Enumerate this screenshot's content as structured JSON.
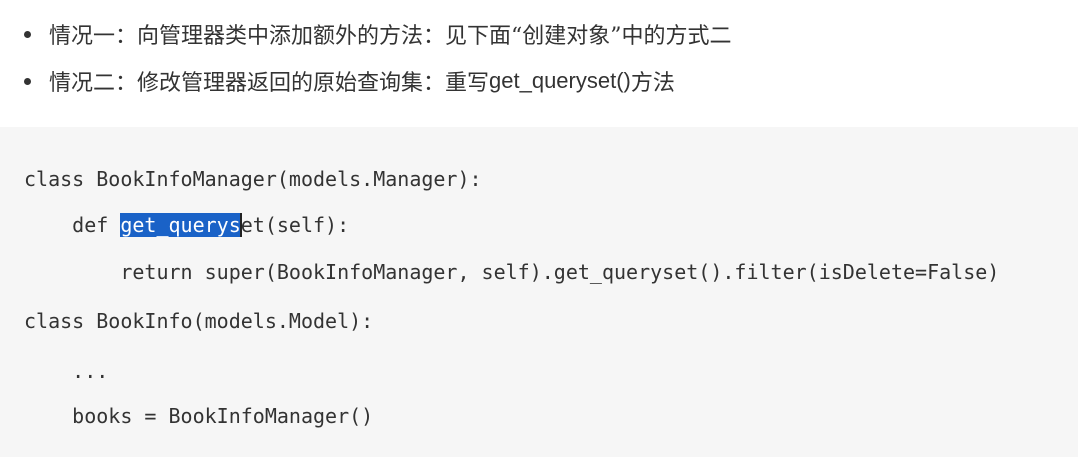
{
  "bullets": [
    {
      "text": "情况一：向管理器类中添加额外的方法：见下面“创建对象”中的方式二"
    },
    {
      "text_before": "情况二：修改管理器返回的原始查询集：重写",
      "text_code": "get_queryset()",
      "text_after": "方法"
    }
  ],
  "code": {
    "line1": "class BookInfoManager(models.Manager):",
    "line2_indent": "    ",
    "line2_prefix": "def ",
    "line2_selected": "get_querys",
    "line2_rest": "et(self):",
    "line3": "        return super(BookInfoManager, self).get_queryset().filter(isDelete=False)",
    "line4": "class BookInfo(models.Model):",
    "line5": "    ...",
    "line6": "    books = BookInfoManager()"
  },
  "colors": {
    "selection": "#1a62c7",
    "code_background": "#f6f6f6",
    "text": "#333333"
  }
}
